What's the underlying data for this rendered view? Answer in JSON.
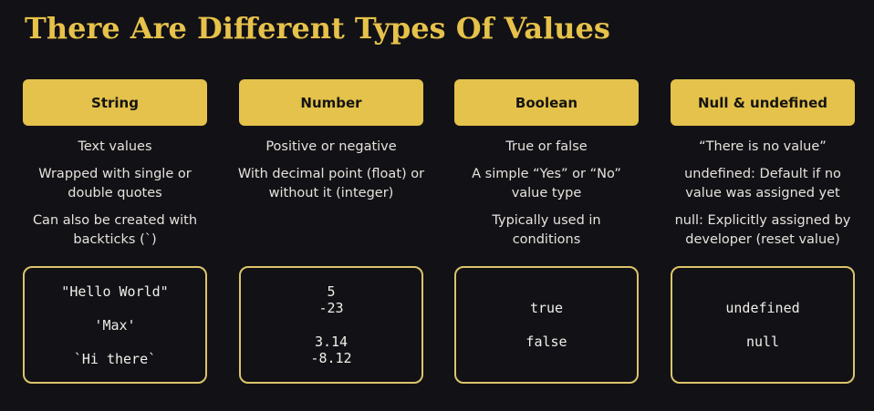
{
  "title": "There Are Different Types Of Values",
  "columns": [
    {
      "header": "String",
      "descriptions": [
        "Text values",
        "Wrapped with single or double quotes",
        "Can also be created with backticks (`)"
      ],
      "code": [
        "\"Hello World\"",
        "'Max'",
        "`Hi there`"
      ]
    },
    {
      "header": "Number",
      "descriptions": [
        "Positive or negative",
        "With decimal point (float) or without it (integer)"
      ],
      "code": [
        "5",
        "-23",
        "3.14",
        "-8.12"
      ]
    },
    {
      "header": "Boolean",
      "descriptions": [
        "True or false",
        "A simple “Yes” or “No” value type",
        "Typically used in conditions"
      ],
      "code": [
        "true",
        "false"
      ]
    },
    {
      "header": "Null & undefined",
      "descriptions": [
        "“There is no value”",
        "undefined: Default if no value was assigned yet",
        "null: Explicitly assigned by developer (reset value)"
      ],
      "code": [
        "undefined",
        "null"
      ]
    }
  ]
}
